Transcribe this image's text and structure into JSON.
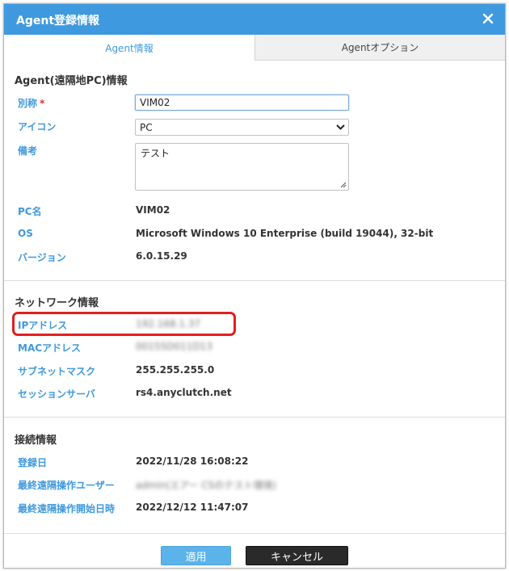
{
  "dialog": {
    "title": "Agent登録情報",
    "close_label": "×"
  },
  "tabs": [
    {
      "label": "Agent情報",
      "active": true
    },
    {
      "label": "Agentオプション",
      "active": false
    }
  ],
  "agent_section": {
    "title": "Agent(遠隔地PC)情報",
    "alias_label": "別称",
    "required_mark": "*",
    "alias_value": "VIM02",
    "icon_label": "アイコン",
    "icon_selected": "PC",
    "notes_label": "備考",
    "notes_value": "テスト",
    "pc_name_label": "PC名",
    "pc_name_value": "VIM02",
    "os_label": "OS",
    "os_value": "Microsoft Windows 10 Enterprise (build 19044), 32-bit",
    "version_label": "バージョン",
    "version_value": "6.0.15.29"
  },
  "network_section": {
    "title": "ネットワーク情報",
    "ip_label": "IPアドレス",
    "ip_value": "192.168.1.37",
    "mac_label": "MACアドレス",
    "mac_value": "00155D011D13",
    "subnet_label": "サブネットマスク",
    "subnet_value": "255.255.255.0",
    "session_label": "セッションサーバ",
    "session_value": "rs4.anyclutch.net"
  },
  "connection_section": {
    "title": "接続情報",
    "registered_label": "登録日",
    "registered_value": "2022/11/28 16:08:22",
    "last_user_label": "最終遠隔操作ユーザー",
    "last_user_value": "admin(エアー CSのテスト環境)",
    "last_start_label": "最終遠隔操作開始日時",
    "last_start_value": "2022/12/12 11:47:07"
  },
  "buttons": {
    "apply": "適用",
    "cancel": "キャンセル"
  },
  "colors": {
    "accent": "#3f99de",
    "highlight": "#e41e1e",
    "required": "#e03030"
  },
  "icons": {
    "close": "close-icon",
    "select_arrow": "chevron-down-icon",
    "resize": "resize-grip-icon"
  }
}
